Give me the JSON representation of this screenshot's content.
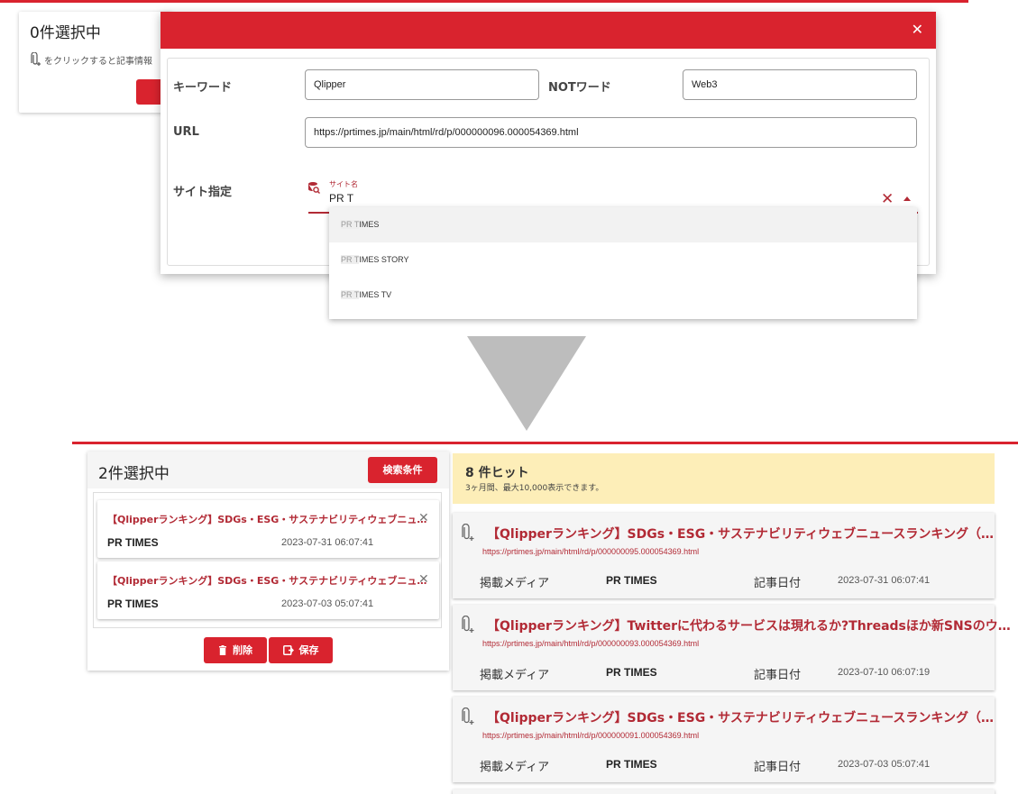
{
  "background_card": {
    "title": "0件選択中",
    "hint": "をクリックすると記事情報"
  },
  "modal": {
    "keyword_label": "キーワード",
    "keyword_value": "Qlipper",
    "notword_label": "NOTワード",
    "notword_value": "Web3",
    "url_label": "URL",
    "url_value": "https://prtimes.jp/main/html/rd/p/000000096.000054369.html",
    "site_label": "サイト指定",
    "site_caption": "サイト名",
    "site_value": "PR T"
  },
  "dropdown": {
    "items": [
      {
        "match": "PR T",
        "rest": "IMES"
      },
      {
        "match": "PR T",
        "rest": "IMES STORY"
      },
      {
        "match": "PR T",
        "rest": "IMES TV"
      }
    ]
  },
  "selection": {
    "title": "2件選択中",
    "condition_button": "検索条件",
    "items": [
      {
        "title": "【Qlipperランキング】SDGs・ESG・サステナビリティウェブニュ…",
        "media": "PR TIMES",
        "date": "2023-07-31 06:07:41"
      },
      {
        "title": "【Qlipperランキング】SDGs・ESG・サステナビリティウェブニュ…",
        "media": "PR TIMES",
        "date": "2023-07-03 05:07:41"
      }
    ],
    "delete_button": "削除",
    "save_button": "保存"
  },
  "hits": {
    "title": "8 件ヒット",
    "subtitle": "3ヶ月間、最大10,000表示できます。"
  },
  "results": [
    {
      "title": "【Qlipperランキング】SDGs・ESG・サステナビリティウェブニュースランキング（…",
      "url": "https://prtimes.jp/main/html/rd/p/000000095.000054369.html",
      "media_label": "掲載メディア",
      "media": "PR TIMES",
      "date_label": "記事日付",
      "date": "2023-07-31 06:07:41"
    },
    {
      "title": "【Qlipperランキング】Twitterに代わるサービスは現れるか?Threadsほか新SNSのウ…",
      "url": "https://prtimes.jp/main/html/rd/p/000000093.000054369.html",
      "media_label": "掲載メディア",
      "media": "PR TIMES",
      "date_label": "記事日付",
      "date": "2023-07-10 06:07:19"
    },
    {
      "title": "【Qlipperランキング】SDGs・ESG・サステナビリティウェブニュースランキング（…",
      "url": "https://prtimes.jp/main/html/rd/p/000000091.000054369.html",
      "media_label": "掲載メディア",
      "media": "PR TIMES",
      "date_label": "記事日付",
      "date": "2023-07-03 05:07:41"
    }
  ],
  "colors": {
    "accent": "#d9232e",
    "link": "#b22a35",
    "banner": "#fdeeb8"
  },
  "icons": [
    "paperclip-add-icon",
    "close-icon",
    "site-search-icon",
    "chevron-up-icon",
    "trash-icon",
    "save-icon"
  ]
}
